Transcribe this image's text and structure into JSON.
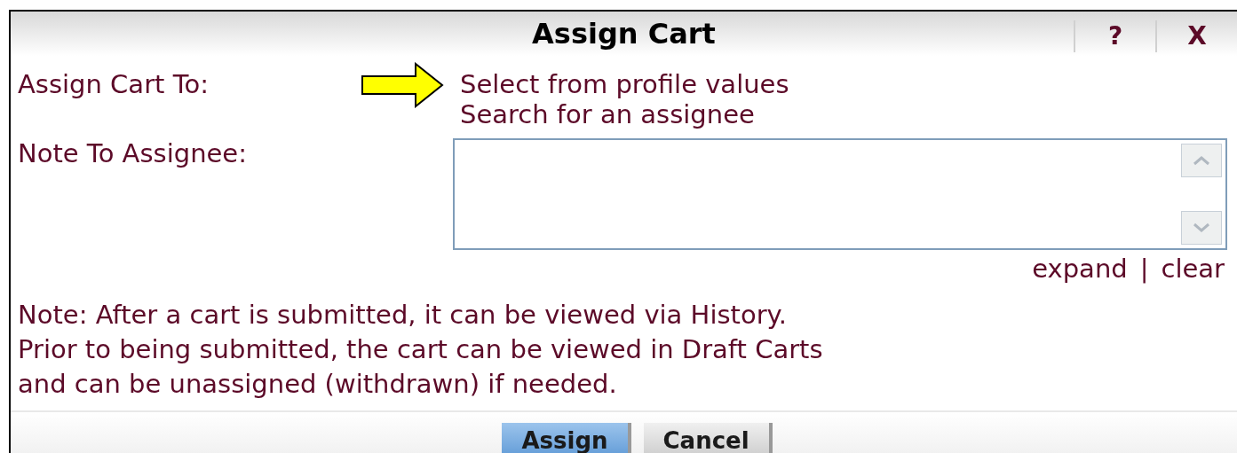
{
  "dialog": {
    "title": "Assign Cart",
    "header_buttons": [
      "?",
      "X"
    ]
  },
  "assign_to": {
    "label": "Assign Cart To:",
    "options": [
      "Select from profile values",
      "Search for an assignee"
    ]
  },
  "note_field": {
    "label": "Note To Assignee:",
    "links": [
      "expand",
      "clear"
    ],
    "separator": "|"
  },
  "note_lines": [
    "Note: After a cart is submitted, it can be viewed via History.",
    "Prior to being submitted, the cart can be viewed in Draft Carts",
    "and can be unassigned (withdrawn) if needed."
  ],
  "buttons": [
    {
      "label": "Assign",
      "kind": "primary"
    },
    {
      "label": "Cancel",
      "kind": "secondary"
    }
  ]
}
